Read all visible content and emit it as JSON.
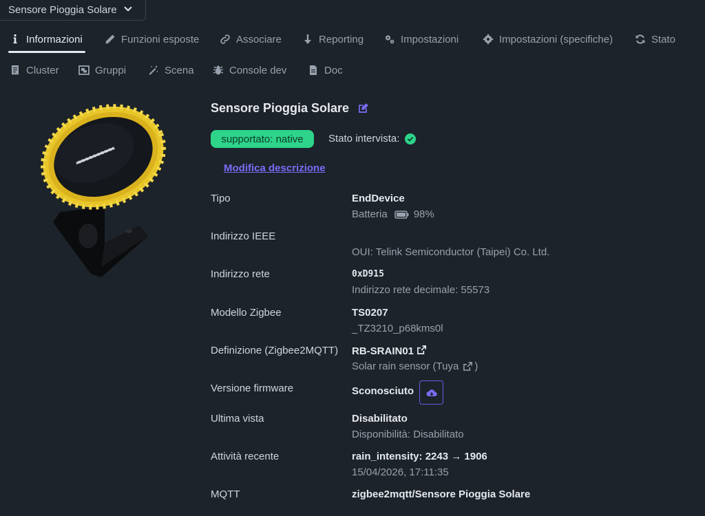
{
  "device_selector": {
    "value": "Sensore Pioggia Solare"
  },
  "tabs_row1": [
    {
      "label": "Informazioni",
      "icon": "info-icon",
      "active": true
    },
    {
      "label": "Funzioni esposte",
      "icon": "pencil-icon"
    },
    {
      "label": "Associare",
      "icon": "link-icon"
    },
    {
      "label": "Reporting",
      "icon": "arrow-down-icon"
    },
    {
      "label": "Impostazioni",
      "icon": "cogs-icon"
    },
    {
      "label": "Impostazioni (specifiche)",
      "icon": "gear-icon"
    },
    {
      "label": "Stato",
      "icon": "refresh-icon"
    }
  ],
  "tabs_row2": [
    {
      "label": "Cluster",
      "icon": "receipt-icon"
    },
    {
      "label": "Gruppi",
      "icon": "object-group-icon"
    },
    {
      "label": "Scena",
      "icon": "magic-wand-icon"
    },
    {
      "label": "Console dev",
      "icon": "bug-icon"
    },
    {
      "label": "Doc",
      "icon": "file-icon"
    }
  ],
  "device": {
    "title": "Sensore Pioggia Solare",
    "support_badge": "supportato: native",
    "interview_label": "Stato intervista:",
    "edit_description": "Modifica descrizione"
  },
  "details": {
    "tipo": {
      "label": "Tipo",
      "value": "EndDevice",
      "sub_label": "Batteria",
      "battery": "98%"
    },
    "ieee": {
      "label": "Indirizzo IEEE",
      "sub": "OUI: Telink Semiconductor (Taipei) Co. Ltd."
    },
    "rete": {
      "label": "Indirizzo rete",
      "value": "0xD915",
      "sub": "Indirizzo rete decimale: 55573"
    },
    "modello": {
      "label": "Modello Zigbee",
      "value": "TS0207",
      "sub": "_TZ3210_p68kms0l"
    },
    "definizione": {
      "label": "Definizione (Zigbee2MQTT)",
      "value": "RB-SRAIN01",
      "sub": "Solar rain sensor (Tuya",
      "sub_suffix": ")"
    },
    "firmware": {
      "label": "Versione firmware",
      "value": "Sconosciuto"
    },
    "ultima_vista": {
      "label": "Ultima vista",
      "value": "Disabilitato",
      "sub": "Disponibilità: Disabilitato"
    },
    "attivita": {
      "label": "Attività recente",
      "value": "rain_intensity: 2243 → 1906",
      "sub": "15/04/2026, 17:11:35"
    },
    "mqtt": {
      "label": "MQTT",
      "value": "zigbee2mqtt/Sensore Pioggia Solare"
    }
  },
  "colors": {
    "accent": "#7b6cf6",
    "success": "#2dd48a",
    "background": "#1d232a"
  }
}
